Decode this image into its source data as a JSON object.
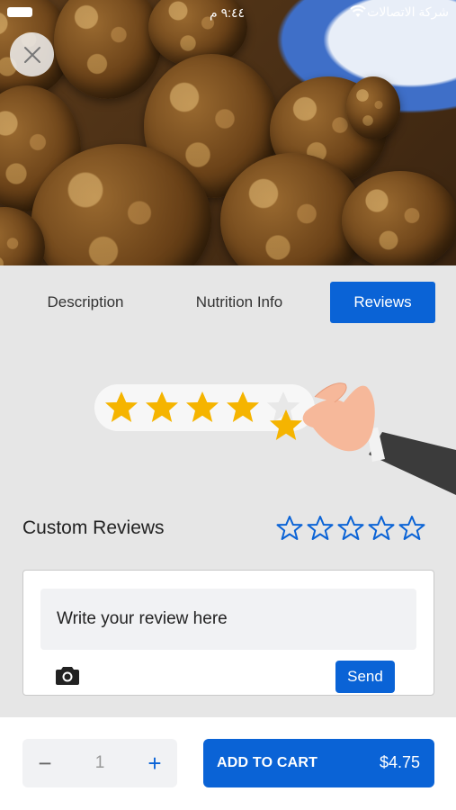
{
  "status_bar": {
    "time": "٩:٤٤ م",
    "carrier": "شركة الاتصالات"
  },
  "tabs": [
    {
      "label": "Description",
      "active": false
    },
    {
      "label": "Nutrition Info",
      "active": false
    },
    {
      "label": "Reviews",
      "active": true
    }
  ],
  "reviews": {
    "title": "Custom Reviews",
    "rating": 0,
    "max_rating": 5,
    "input_placeholder": "Write your review here",
    "send_label": "Send"
  },
  "cart": {
    "quantity": "1",
    "minus_label": "−",
    "plus_label": "+",
    "add_label": "ADD TO CART",
    "price": "$4.75"
  },
  "colors": {
    "accent": "#0a63d6",
    "star_gold": "#f5b400"
  }
}
